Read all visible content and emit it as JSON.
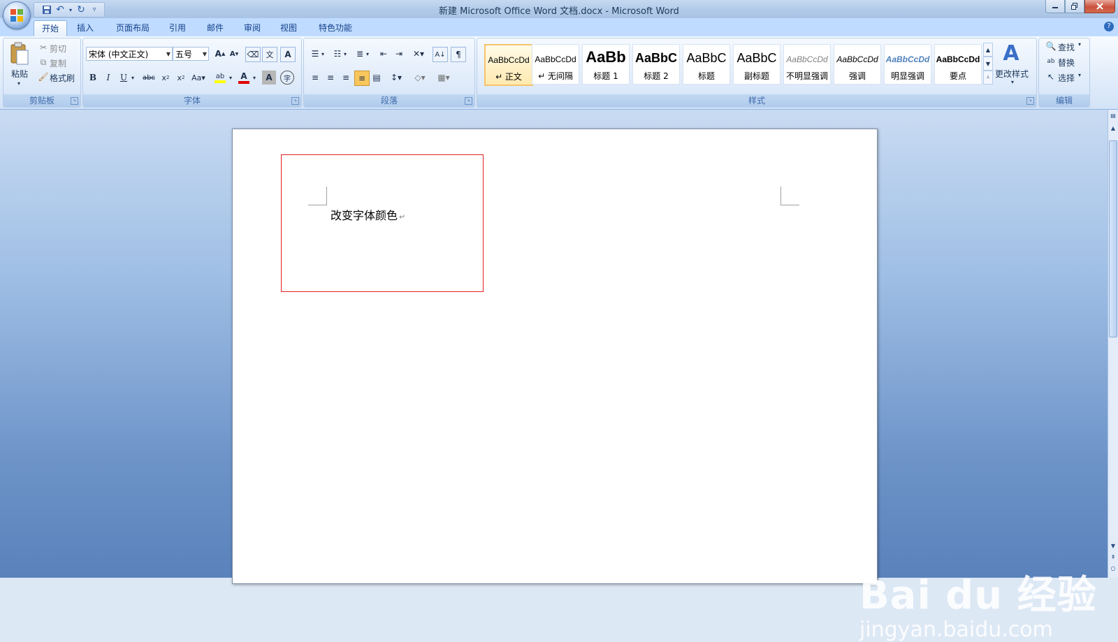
{
  "window": {
    "title": "新建 Microsoft Office Word 文档.docx - Microsoft Word"
  },
  "tabs": [
    {
      "label": "开始",
      "active": true
    },
    {
      "label": "插入"
    },
    {
      "label": "页面布局"
    },
    {
      "label": "引用"
    },
    {
      "label": "邮件"
    },
    {
      "label": "审阅"
    },
    {
      "label": "视图"
    },
    {
      "label": "特色功能"
    }
  ],
  "clipboard": {
    "paste_label": "粘贴",
    "cut_label": "剪切",
    "copy_label": "复制",
    "format_painter_label": "格式刷",
    "group_label": "剪贴板"
  },
  "font": {
    "font_name": "宋体 (中文正文)",
    "font_size": "五号",
    "group_label": "字体"
  },
  "paragraph": {
    "group_label": "段落"
  },
  "styles": {
    "items": [
      {
        "sample": "AaBbCcDd",
        "name": "↵ 正文",
        "selected": true
      },
      {
        "sample": "AaBbCcDd",
        "name": "↵ 无间隔"
      },
      {
        "sample": "AaBb",
        "name": "标题 1"
      },
      {
        "sample": "AaBbC",
        "name": "标题 2"
      },
      {
        "sample": "AaBbC",
        "name": "标题"
      },
      {
        "sample": "AaBbC",
        "name": "副标题"
      },
      {
        "sample": "AaBbCcDd",
        "name": "不明显强调"
      },
      {
        "sample": "AaBbCcDd",
        "name": "强调"
      },
      {
        "sample": "AaBbCcDd",
        "name": "明显强调"
      },
      {
        "sample": "AaBbCcDd",
        "name": "要点"
      }
    ],
    "change_styles_label": "更改样式",
    "group_label": "样式"
  },
  "editing": {
    "find_label": "查找",
    "replace_label": "替换",
    "select_label": "选择",
    "group_label": "编辑"
  },
  "document": {
    "text": "改变字体颜色",
    "paragraph_mark": "↵"
  },
  "watermark": {
    "brand": "Bai du 经验",
    "url": "jingyan.baidu.com"
  },
  "colors": {
    "highlight_border": "#e32020",
    "ribbon_text": "#15428b",
    "font_color_bar": "#e00000",
    "highlight_bar": "#ffff00"
  }
}
